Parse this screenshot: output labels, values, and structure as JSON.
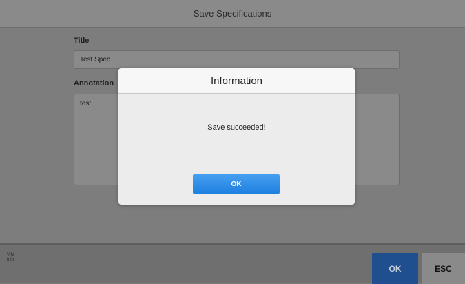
{
  "header": {
    "title": "Save Specifications"
  },
  "form": {
    "title_label": "Title",
    "title_value": "Test Spec",
    "annotation_label": "Annotation",
    "annotation_value": "test"
  },
  "footer": {
    "vin_info": "VIN:\nInfo:",
    "ok_label": "OK",
    "esc_label": "ESC"
  },
  "dialog": {
    "title": "Information",
    "message": "Save succeeded!",
    "ok_label": "OK"
  },
  "colors": {
    "dialog_button": "#2b8ae8",
    "footer_ok": "#1f4f8e"
  }
}
